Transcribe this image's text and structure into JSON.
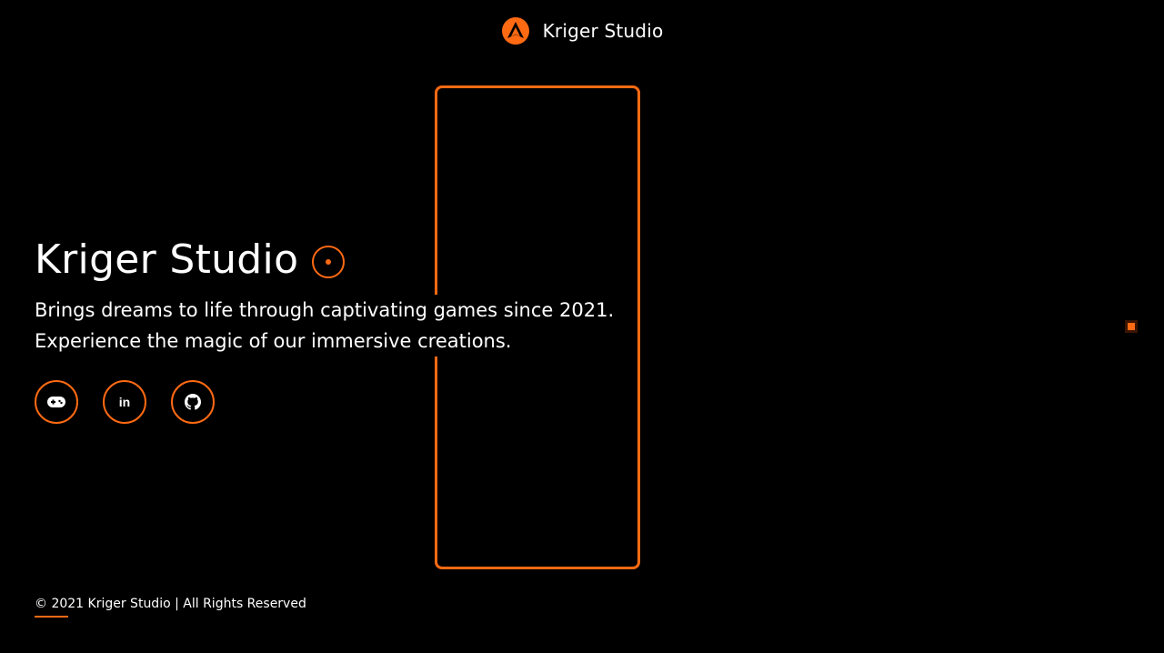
{
  "header": {
    "brand_name": "Kriger Studio",
    "logo_icon": "kriger-logo-icon"
  },
  "hero": {
    "title": "Kriger Studio",
    "title_icon": "target-dot-icon",
    "description_lines": [
      "Brings dreams to life through captivating games since 2021.",
      "Experience the magic of our immersive creations."
    ]
  },
  "social": [
    {
      "name": "gamepad-icon"
    },
    {
      "name": "linkedin-icon",
      "glyph": "in"
    },
    {
      "name": "github-icon"
    }
  ],
  "footer": {
    "copyright": "© 2021 Kriger Studio | All Rights Reserved"
  },
  "colors": {
    "accent": "#ff6a13",
    "background": "#000000",
    "text": "#ffffff"
  }
}
